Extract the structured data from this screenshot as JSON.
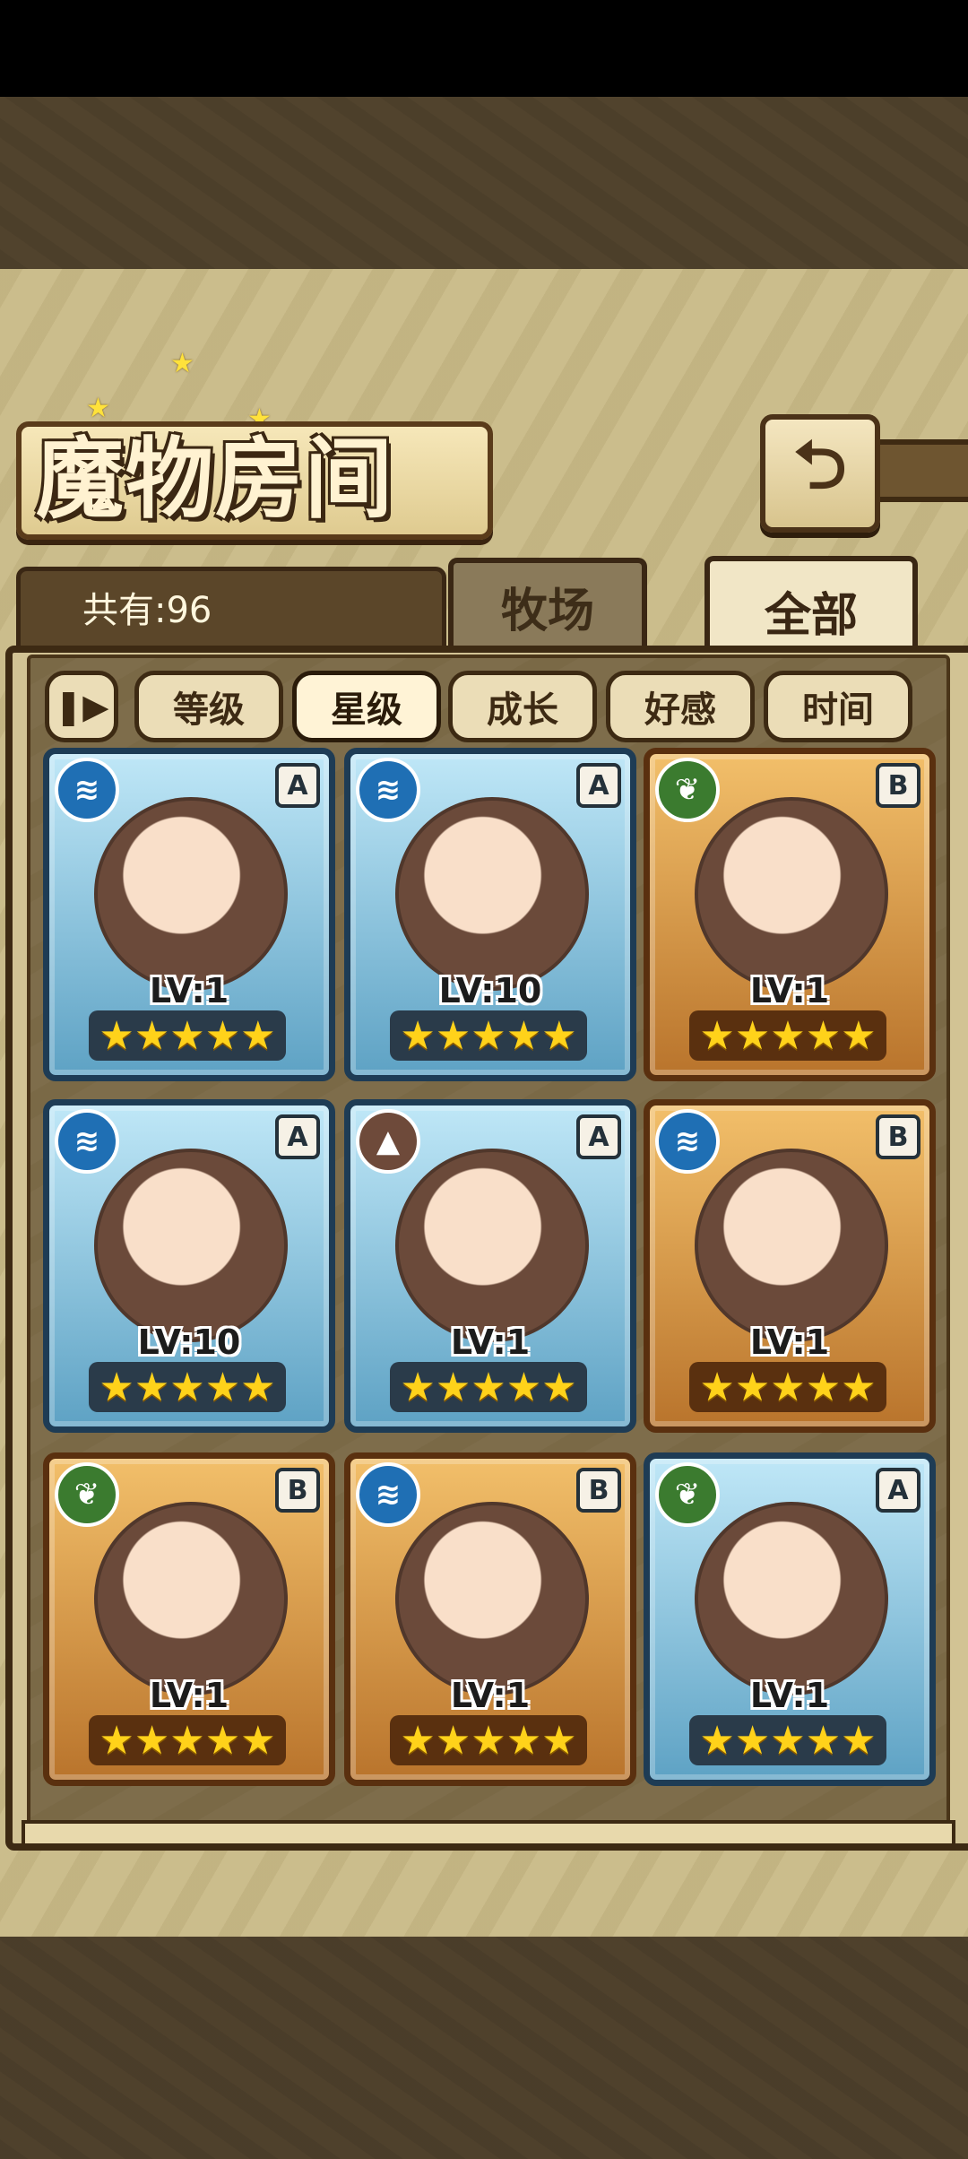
{
  "header": {
    "title": "魔物房间",
    "back_icon": "⮌"
  },
  "count": {
    "label": "共有:96"
  },
  "tabs": [
    {
      "label": "牧场",
      "active": false
    },
    {
      "label": "全部",
      "active": true
    }
  ],
  "filters": {
    "toggle_icon": "❚▶",
    "items": [
      {
        "label": "等级",
        "active": false
      },
      {
        "label": "星级",
        "active": true
      },
      {
        "label": "成长",
        "active": false
      },
      {
        "label": "好感",
        "active": false
      },
      {
        "label": "时间",
        "active": false
      }
    ]
  },
  "cards": [
    {
      "element": "water",
      "rank": "A",
      "level": "LV:1",
      "stars": "★★★★★"
    },
    {
      "element": "water",
      "rank": "A",
      "level": "LV:10",
      "stars": "★★★★★"
    },
    {
      "element": "leaf",
      "rank": "B",
      "level": "LV:1",
      "stars": "★★★★★"
    },
    {
      "element": "water",
      "rank": "A",
      "level": "LV:10",
      "stars": "★★★★★"
    },
    {
      "element": "earth",
      "rank": "A",
      "level": "LV:1",
      "stars": "★★★★★"
    },
    {
      "element": "water",
      "rank": "B",
      "level": "LV:1",
      "stars": "★★★★★"
    },
    {
      "element": "leaf",
      "rank": "B",
      "level": "LV:1",
      "stars": "★★★★★"
    },
    {
      "element": "water",
      "rank": "B",
      "level": "LV:1",
      "stars": "★★★★★"
    },
    {
      "element": "leaf",
      "rank": "A",
      "level": "LV:1",
      "stars": "★★★★★"
    }
  ],
  "colors": {
    "water": "#1f6fb4",
    "leaf": "#3b7b2f",
    "earth": "#6e4a3a",
    "panel": "#d2c394",
    "star": "#ffd21a"
  }
}
